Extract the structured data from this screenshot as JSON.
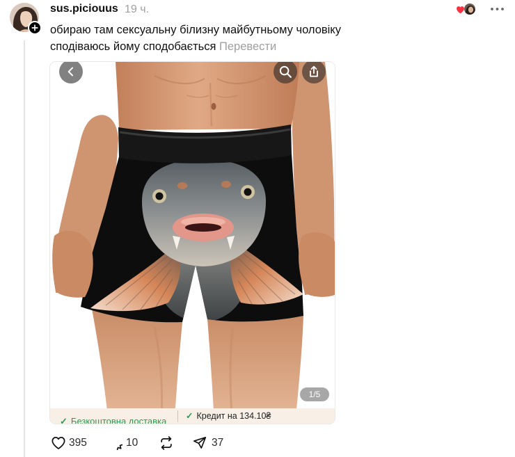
{
  "post": {
    "author": {
      "username": "sus.piciouus",
      "avatar_icon": "user-avatar",
      "follow_badge_icon": "plus-icon"
    },
    "time": "19 ч.",
    "text_lines": [
      "обираю там сексуальну білизну майбутньому чоловіку",
      "сподіваюсь йому сподобається"
    ],
    "translate_label": "Перевести",
    "liked_by_icon": "heart-icon",
    "more_icon": "more-icon"
  },
  "media": {
    "counter": "1/5",
    "embedded_ui": {
      "back_icon": "chevron-left-icon",
      "search_icon": "search-icon",
      "share_icon": "share-icon"
    },
    "banner": {
      "check_glyph": "✓",
      "left_text": "Безкоштовна доставка",
      "right_text": "Кредит на 134.10₴"
    }
  },
  "actions": {
    "like_icon": "heart-outline-icon",
    "comment_icon": "comment-icon",
    "repost_icon": "repost-icon",
    "share_icon": "send-icon",
    "like_count": "395",
    "comment_count": "10",
    "share_count": "37"
  },
  "colors": {
    "text_primary": "#101010",
    "text_secondary": "#a0a0a0",
    "like_red": "#ff3040",
    "banner_bg": "#f8f0e6",
    "check_green": "#2e9a52"
  }
}
